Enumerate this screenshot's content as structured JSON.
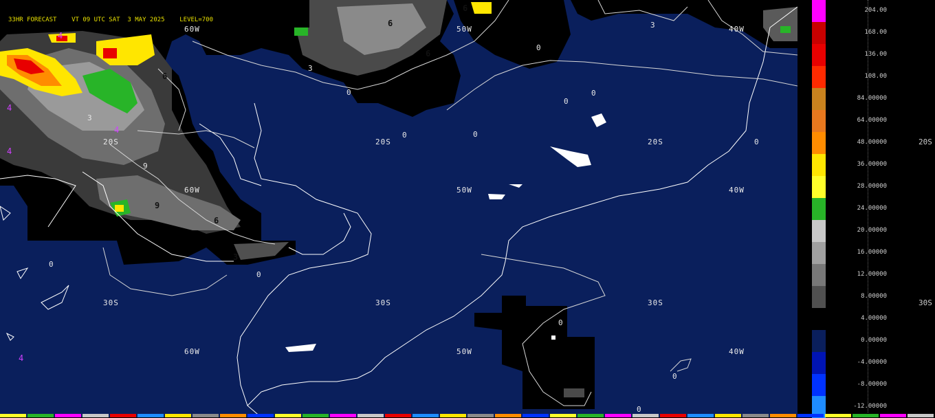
{
  "header": {
    "text": "33HR FORECAST    VT 09 UTC SAT  3 MAY 2025    LEVEL=700"
  },
  "grid_labels": [
    {
      "text": "60W"
    },
    {
      "text": "50W"
    },
    {
      "text": "40W"
    },
    {
      "text": "20S"
    },
    {
      "text": "20S"
    },
    {
      "text": "20S"
    },
    {
      "text": "60W"
    },
    {
      "text": "50W"
    },
    {
      "text": "40W"
    },
    {
      "text": "30S"
    },
    {
      "text": "30S"
    },
    {
      "text": "30S"
    },
    {
      "text": "60W"
    },
    {
      "text": "50W"
    },
    {
      "text": "40W"
    },
    {
      "text": "20S"
    },
    {
      "text": "30S"
    }
  ],
  "contour_labels": [
    {
      "text": "0"
    },
    {
      "text": "0"
    },
    {
      "text": "0"
    },
    {
      "text": "0"
    },
    {
      "text": "0"
    },
    {
      "text": "0"
    },
    {
      "text": "0"
    },
    {
      "text": "0"
    },
    {
      "text": "0"
    },
    {
      "text": "0"
    },
    {
      "text": "0"
    },
    {
      "text": "0"
    },
    {
      "text": "3"
    },
    {
      "text": "3"
    },
    {
      "text": "3"
    },
    {
      "text": "6"
    },
    {
      "text": "6"
    },
    {
      "text": "6"
    },
    {
      "text": "6"
    },
    {
      "text": "6"
    },
    {
      "text": "9"
    },
    {
      "text": "9"
    },
    {
      "text": "3"
    },
    {
      "text": "4"
    },
    {
      "text": "4"
    },
    {
      "text": "4"
    },
    {
      "text": "4"
    },
    {
      "text": "4"
    }
  ],
  "legend": {
    "ticks": [
      "204.00",
      "168.00",
      "136.00",
      "108.00",
      "84.00000",
      "64.00000",
      "48.00000",
      "36.00000",
      "28.00000",
      "24.00000",
      "20.00000",
      "16.00000",
      "12.00000",
      "8.00000",
      "4.00000",
      "0.00000",
      "-4.00000",
      "-8.00000",
      "-12.00000"
    ],
    "colors": [
      "#ff00ff",
      "#c80000",
      "#e80000",
      "#ff2a00",
      "#c8821e",
      "#e8781e",
      "#ff8c00",
      "#ffe600",
      "#ffff2a",
      "#28b428",
      "#c8c8c8",
      "#a0a0a0",
      "#787878",
      "#505050",
      "#000000",
      "#0a1f5c",
      "#0014b4",
      "#0032ff",
      "#1e8cff"
    ]
  }
}
